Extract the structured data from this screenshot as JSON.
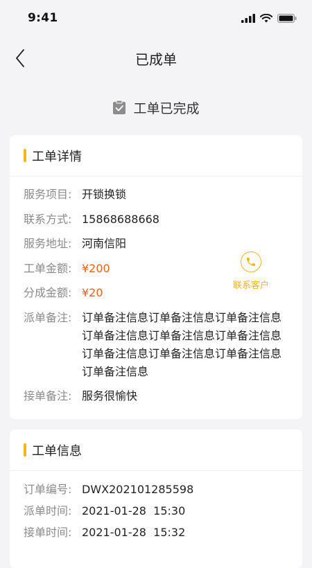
{
  "status_bar": {
    "time": "9:41"
  },
  "nav": {
    "title": "已成单"
  },
  "status": {
    "text": "工单已完成"
  },
  "detail": {
    "title": "工单详情",
    "rows": [
      {
        "label": "服务项目:",
        "value": "开锁换锁"
      },
      {
        "label": "联系方式:",
        "value": "15868688668"
      },
      {
        "label": "服务地址:",
        "value": "河南信阳"
      },
      {
        "label": "工单金额:",
        "value": "¥200"
      },
      {
        "label": "分成金额:",
        "value": "¥20"
      },
      {
        "label": "派单备注:",
        "value": "订单备注信息订单备注信息订单备注信息订单备注信息订单备注信息订单备注信息订单备注信息订单备注信息订单备注信息订单备注信息"
      },
      {
        "label": "接单备注:",
        "value": "服务很愉快"
      }
    ],
    "contact_label": "联系客户"
  },
  "info": {
    "title": "工单信息",
    "rows": [
      {
        "label": "订单编号:",
        "value": "DWX202101285598"
      },
      {
        "label": "派单时间:",
        "value": "2021-01-28  15:30"
      },
      {
        "label": "接单时间:",
        "value": "2021-01-28  15:32"
      }
    ]
  },
  "colors": {
    "accent": "#f5b516",
    "amount": "#e8611a",
    "background": "#f4f4f6"
  }
}
